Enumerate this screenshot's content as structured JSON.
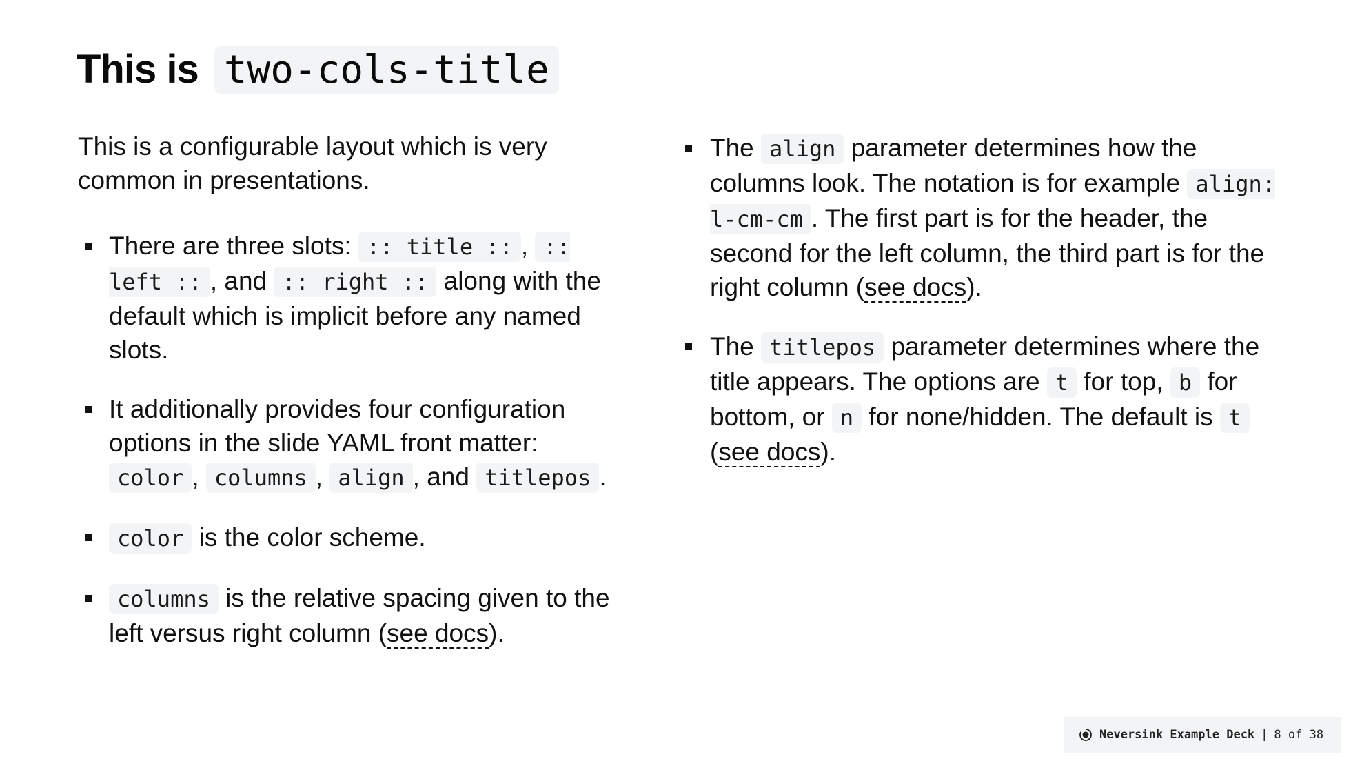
{
  "slide": {
    "title_prefix": "This is",
    "title_code": "two-cols-title"
  },
  "left": {
    "intro": "This is a configurable layout which is very common in presentations.",
    "items": [
      {
        "t0": "There are three slots: ",
        "c0": ":: title ::",
        "t1": ", ",
        "c1": ":: left ::",
        "t2": ", and ",
        "c2": ":: right ::",
        "t3": " along with the default which is implicit before any named slots."
      },
      {
        "t0": "It additionally provides four configuration options in the slide YAML front matter: ",
        "c0": "color",
        "t1": ", ",
        "c1": "columns",
        "t2": ", ",
        "c2": "align",
        "t3": ", and ",
        "c3": "titlepos",
        "t4": "."
      },
      {
        "c0": "color",
        "t0": " is the color scheme."
      },
      {
        "c0": "columns",
        "t0": " is the relative spacing given to the left versus right column (",
        "link": "see docs",
        "t1": ")."
      }
    ]
  },
  "right": {
    "items": [
      {
        "t0": "The ",
        "c0": "align",
        "t1": " parameter determines how the columns look. The notation is for example ",
        "c1": "align: l-cm-cm",
        "t2": ". The first part is for the header, the second for the left column, the third part is for the right column (",
        "link": "see docs",
        "t3": ")."
      },
      {
        "t0": "The ",
        "c0": "titlepos",
        "t1": " parameter determines where the title appears. The options are ",
        "c1": "t",
        "t2": " for top, ",
        "c2": "b",
        "t3": " for bottom, or ",
        "c3": "n",
        "t4": " for none/hidden. The default is ",
        "c4": "t",
        "t5": " (",
        "link": "see docs",
        "t6": ")."
      }
    ]
  },
  "footer": {
    "icon": "neversink-logo-icon",
    "deck_name": "Neversink Example Deck",
    "separator": "|",
    "page_text": "8 of 38",
    "page_current": 8,
    "page_total": 38
  }
}
